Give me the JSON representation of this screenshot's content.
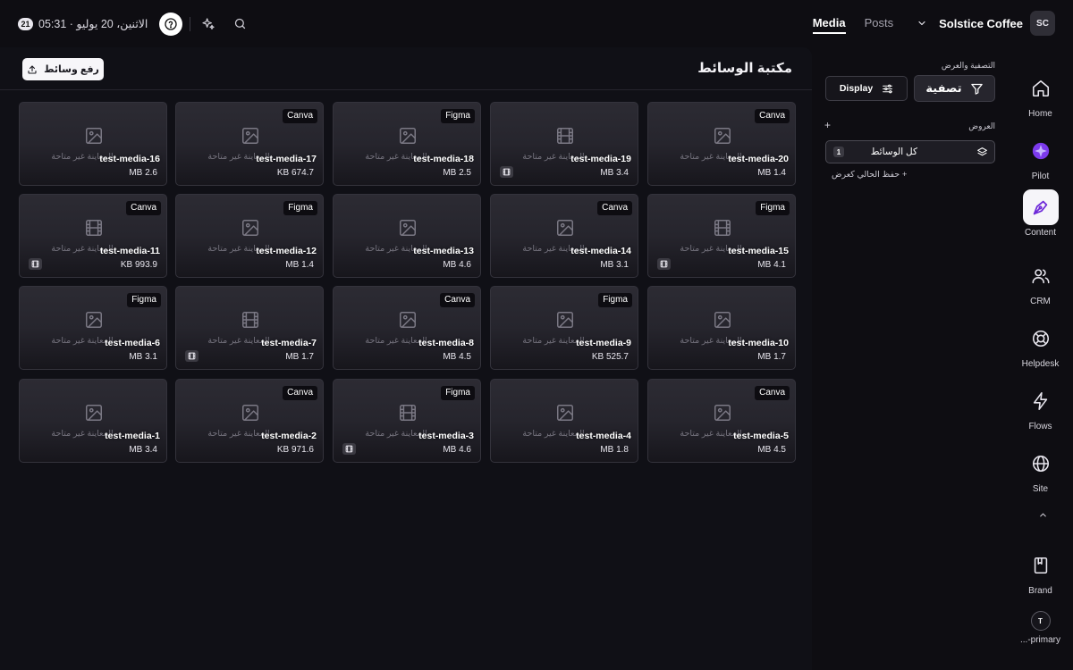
{
  "topbar": {
    "date_badge": "21",
    "datetime": "الاثنين، 20 يوليو · 05:31",
    "tabs": [
      {
        "label": "Media",
        "active": true
      },
      {
        "label": "Posts",
        "active": false
      }
    ],
    "workspace_name": "Solstice Coffee",
    "workspace_initials": "SC"
  },
  "main": {
    "title": "مكتبة الوسائط",
    "upload_label": "رفع وسائط",
    "unavailable_text": "المعاينة غير متاحة",
    "items": [
      {
        "name": "test-media-20",
        "size": "1.4 MB",
        "source": "Canva",
        "type": "image"
      },
      {
        "name": "test-media-19",
        "size": "3.4 MB",
        "source": "",
        "type": "video"
      },
      {
        "name": "test-media-18",
        "size": "2.5 MB",
        "source": "Figma",
        "type": "image"
      },
      {
        "name": "test-media-17",
        "size": "674.7 KB",
        "source": "Canva",
        "type": "image"
      },
      {
        "name": "test-media-16",
        "size": "2.6 MB",
        "source": "",
        "type": "image"
      },
      {
        "name": "test-media-15",
        "size": "4.1 MB",
        "source": "Figma",
        "type": "video"
      },
      {
        "name": "test-media-14",
        "size": "3.1 MB",
        "source": "Canva",
        "type": "image"
      },
      {
        "name": "test-media-13",
        "size": "4.6 MB",
        "source": "",
        "type": "image"
      },
      {
        "name": "test-media-12",
        "size": "1.4 MB",
        "source": "Figma",
        "type": "image"
      },
      {
        "name": "test-media-11",
        "size": "993.9 KB",
        "source": "Canva",
        "type": "video"
      },
      {
        "name": "test-media-10",
        "size": "1.7 MB",
        "source": "",
        "type": "image"
      },
      {
        "name": "test-media-9",
        "size": "525.7 KB",
        "source": "Figma",
        "type": "image"
      },
      {
        "name": "test-media-8",
        "size": "4.5 MB",
        "source": "Canva",
        "type": "image"
      },
      {
        "name": "test-media-7",
        "size": "1.7 MB",
        "source": "",
        "type": "video"
      },
      {
        "name": "test-media-6",
        "size": "3.1 MB",
        "source": "Figma",
        "type": "image"
      },
      {
        "name": "test-media-5",
        "size": "4.5 MB",
        "source": "Canva",
        "type": "image"
      },
      {
        "name": "test-media-4",
        "size": "1.8 MB",
        "source": "",
        "type": "image"
      },
      {
        "name": "test-media-3",
        "size": "4.6 MB",
        "source": "Figma",
        "type": "video"
      },
      {
        "name": "test-media-2",
        "size": "971.6 KB",
        "source": "Canva",
        "type": "image"
      },
      {
        "name": "test-media-1",
        "size": "3.4 MB",
        "source": "",
        "type": "image"
      }
    ]
  },
  "filters": {
    "section_label": "التصفية والعرض",
    "filter_label": "تصفية",
    "display_label": "Display",
    "views_label": "العروض",
    "views_add": "+",
    "view_item_label": "كل الوسائط",
    "view_item_count": "1",
    "save_view_label": "+ حفظ الحالي كعرض"
  },
  "sidenav": {
    "items": [
      {
        "label": "Home",
        "icon": "home-icon",
        "active": false
      },
      {
        "label": "Pilot",
        "icon": "pilot-icon",
        "active": false
      },
      {
        "label": "Content",
        "icon": "content-pen-icon",
        "active": true
      },
      {
        "label": "CRM",
        "icon": "users-icon",
        "active": false
      },
      {
        "label": "Helpdesk",
        "icon": "lifebuoy-icon",
        "active": false
      },
      {
        "label": "Flows",
        "icon": "bolt-icon",
        "active": false
      },
      {
        "label": "Site",
        "icon": "globe-icon",
        "active": false
      },
      {
        "label": "Brand",
        "icon": "book-icon",
        "active": false
      }
    ],
    "tenant_initial": "T",
    "tenant_label": "...-primary"
  },
  "colors": {
    "background": "#0e0d12",
    "panel": "#101016",
    "card": "#2c2b33",
    "pilot_accent": "#a855f7",
    "text": "#e8e6ee"
  }
}
